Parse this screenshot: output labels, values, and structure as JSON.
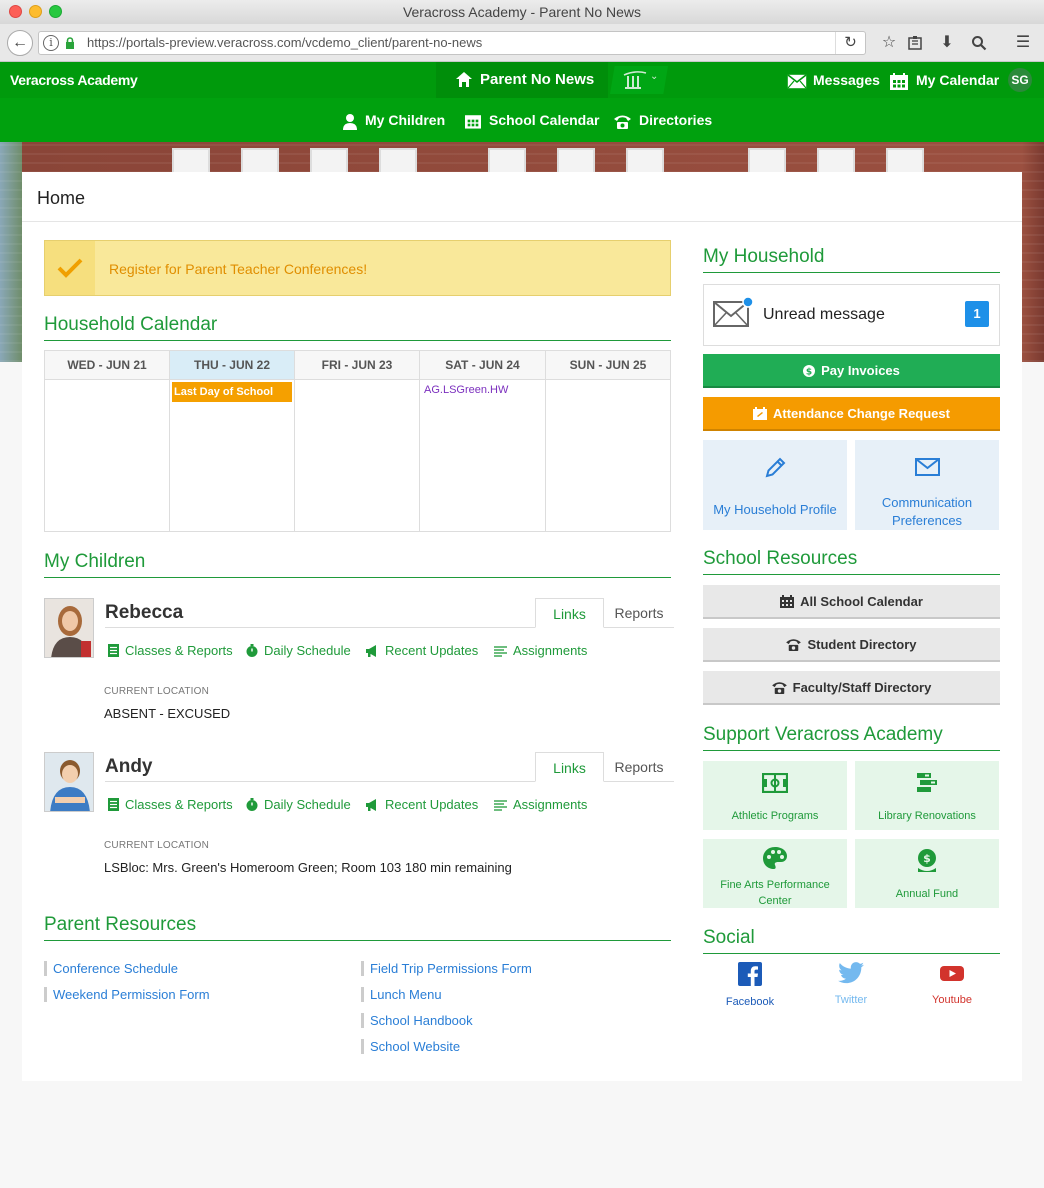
{
  "browser": {
    "window_title": "Veracross Academy - Parent No News",
    "url": "https://portals-preview.veracross.com/vcdemo_client/parent-no-news"
  },
  "nav": {
    "brand": "Veracross Academy",
    "active": "Parent No News",
    "messages": "Messages",
    "my_calendar": "My Calendar",
    "avatar_initials": "SG",
    "sub_items": [
      "My Children",
      "School Calendar",
      "Directories"
    ]
  },
  "page": {
    "title": "Home"
  },
  "alert": {
    "text": "Register for Parent Teacher Conferences!"
  },
  "household_calendar": {
    "title": "Household Calendar",
    "days": [
      {
        "label": "WED - JUN 21",
        "today": false
      },
      {
        "label": "THU - JUN 22",
        "today": true
      },
      {
        "label": "FRI - JUN 23",
        "today": false
      },
      {
        "label": "SAT - JUN 24",
        "today": false
      },
      {
        "label": "SUN - JUN 25",
        "today": false
      }
    ],
    "events": {
      "thu": "Last Day of School",
      "sat": "AG.LSGreen.HW"
    }
  },
  "my_children": {
    "title": "My Children",
    "tabs": [
      "Links",
      "Reports"
    ],
    "links": [
      "Classes & Reports",
      "Daily Schedule",
      "Recent Updates",
      "Assignments"
    ],
    "location_label": "CURRENT LOCATION",
    "children": [
      {
        "name": "Rebecca",
        "location": "ABSENT - EXCUSED"
      },
      {
        "name": "Andy",
        "location": "LSBloc: Mrs. Green's Homeroom Green; Room 103 180 min remaining"
      }
    ]
  },
  "parent_resources": {
    "title": "Parent Resources",
    "left": [
      "Conference Schedule",
      "Weekend Permission Form"
    ],
    "right": [
      "Field Trip Permissions Form",
      "Lunch Menu",
      "School Handbook",
      "School Website"
    ]
  },
  "my_household": {
    "title": "My Household",
    "unread_label": "Unread message",
    "unread_count": "1",
    "pay_invoices": "Pay Invoices",
    "attendance_change": "Attendance Change Request",
    "tiles": [
      "My Household Profile",
      "Communication Preferences"
    ]
  },
  "school_resources": {
    "title": "School Resources",
    "buttons": [
      "All School Calendar",
      "Student Directory",
      "Faculty/Staff Directory"
    ]
  },
  "support": {
    "title": "Support Veracross Academy",
    "tiles": [
      "Athletic Programs",
      "Library Renovations",
      "Fine Arts Performance Center",
      "Annual Fund"
    ]
  },
  "social": {
    "title": "Social",
    "items": [
      {
        "label": "Facebook",
        "color": "#1c5bb8"
      },
      {
        "label": "Twitter",
        "color": "#74b9ef"
      },
      {
        "label": "Youtube",
        "color": "#d2332c"
      }
    ]
  },
  "colors": {
    "nav_green": "#009a0c",
    "accent_green": "#1f9a3a",
    "link_blue": "#2a7ed6",
    "orange": "#f59b00"
  }
}
